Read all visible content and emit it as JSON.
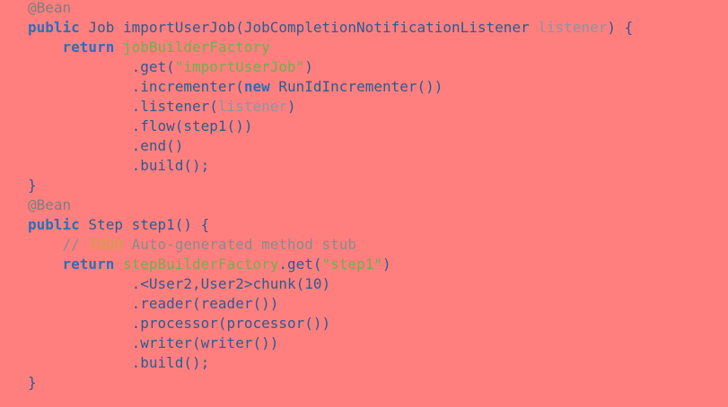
{
  "code": {
    "colors": {
      "background": "#FF7F7F",
      "annotation": "#7E7E7E",
      "keyword": "#2B6FB8",
      "plain": "#2B5C8F",
      "parameter": "#8A95A3",
      "field": "#6FB04D",
      "string": "#6FB04D",
      "comment": "#8A8A8A",
      "todo": "#C9A23F"
    },
    "lines": [
      {
        "tokens": [
          {
            "t": "@Bean",
            "k": "ann"
          }
        ]
      },
      {
        "tokens": [
          {
            "t": "public",
            "k": "kw"
          },
          {
            "t": " Job importUserJob(JobCompletionNotificationListener ",
            "k": "plain"
          },
          {
            "t": "listener",
            "k": "param"
          },
          {
            "t": ") {",
            "k": "plain"
          }
        ]
      },
      {
        "tokens": [
          {
            "t": "    ",
            "k": "plain"
          },
          {
            "t": "return",
            "k": "kw"
          },
          {
            "t": " ",
            "k": "plain"
          },
          {
            "t": "jobBuilderFactory",
            "k": "field"
          }
        ]
      },
      {
        "tokens": [
          {
            "t": "            .get(",
            "k": "plain"
          },
          {
            "t": "\"importUserJob\"",
            "k": "str"
          },
          {
            "t": ")",
            "k": "plain"
          }
        ]
      },
      {
        "tokens": [
          {
            "t": "            .incrementer(",
            "k": "plain"
          },
          {
            "t": "new",
            "k": "kw"
          },
          {
            "t": " RunIdIncrementer())",
            "k": "plain"
          }
        ]
      },
      {
        "tokens": [
          {
            "t": "            .listener(",
            "k": "plain"
          },
          {
            "t": "listener",
            "k": "param"
          },
          {
            "t": ")",
            "k": "plain"
          }
        ]
      },
      {
        "tokens": [
          {
            "t": "            .flow(step1())",
            "k": "plain"
          }
        ]
      },
      {
        "tokens": [
          {
            "t": "            .end()",
            "k": "plain"
          }
        ]
      },
      {
        "tokens": [
          {
            "t": "            .build();",
            "k": "plain"
          }
        ]
      },
      {
        "tokens": [
          {
            "t": "}",
            "k": "plain"
          }
        ]
      },
      {
        "tokens": [
          {
            "t": "@Bean",
            "k": "ann"
          }
        ]
      },
      {
        "tokens": [
          {
            "t": "public",
            "k": "kw"
          },
          {
            "t": " Step step1() {",
            "k": "plain"
          }
        ]
      },
      {
        "tokens": [
          {
            "t": "    // ",
            "k": "comment"
          },
          {
            "t": "TODO",
            "k": "todo"
          },
          {
            "t": " Auto-generated method stub",
            "k": "comment"
          }
        ]
      },
      {
        "tokens": [
          {
            "t": "    ",
            "k": "plain"
          },
          {
            "t": "return",
            "k": "kw"
          },
          {
            "t": " ",
            "k": "plain"
          },
          {
            "t": "stepBuilderFactory",
            "k": "field"
          },
          {
            "t": ".get(",
            "k": "plain"
          },
          {
            "t": "\"step1\"",
            "k": "str"
          },
          {
            "t": ")",
            "k": "plain"
          }
        ]
      },
      {
        "tokens": [
          {
            "t": "            .<User2,User2>chunk(10)",
            "k": "plain"
          }
        ]
      },
      {
        "tokens": [
          {
            "t": "            .reader(reader())",
            "k": "plain"
          }
        ]
      },
      {
        "tokens": [
          {
            "t": "            .processor(processor())",
            "k": "plain"
          }
        ]
      },
      {
        "tokens": [
          {
            "t": "            .writer(writer())",
            "k": "plain"
          }
        ]
      },
      {
        "tokens": [
          {
            "t": "            .build();",
            "k": "plain"
          }
        ]
      },
      {
        "tokens": [
          {
            "t": "}",
            "k": "plain"
          }
        ]
      }
    ]
  }
}
